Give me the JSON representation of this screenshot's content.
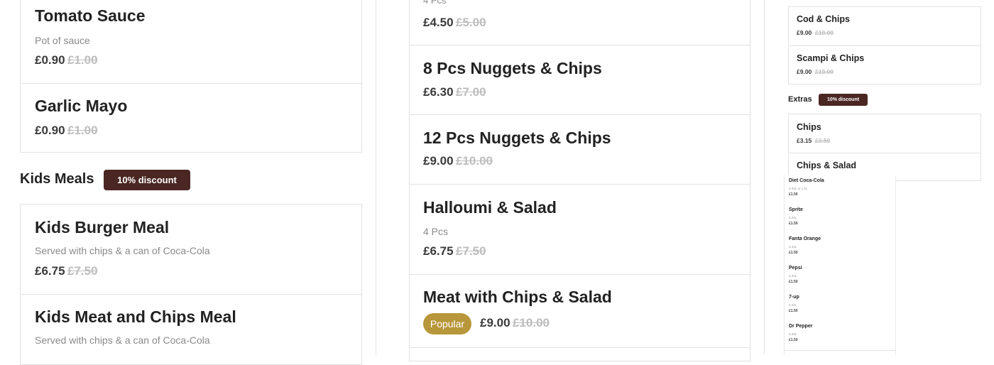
{
  "left": {
    "tomato": {
      "name": "Tomato Sauce",
      "desc": "Pot of sauce",
      "price": "£0.90",
      "old_price": "£1.00"
    },
    "garlic": {
      "name": "Garlic Mayo",
      "price": "£0.90",
      "old_price": "£1.00"
    },
    "kids_section": {
      "title": "Kids Meals",
      "badge": "10% discount"
    },
    "kids_burger": {
      "name": "Kids Burger Meal",
      "desc": "Served with chips & a can of Coca-Cola",
      "price": "£6.75",
      "old_price": "£7.50"
    },
    "kids_meat": {
      "name": "Kids Meat and Chips Meal",
      "desc": "Served with chips & a can of Coca-Cola"
    }
  },
  "middle": {
    "top_partial": {
      "desc": "4 Pcs",
      "price": "£4.50",
      "old_price": "£5.00"
    },
    "nuggets8": {
      "name": "8 Pcs Nuggets & Chips",
      "price": "£6.30",
      "old_price": "£7.00"
    },
    "nuggets12": {
      "name": "12 Pcs Nuggets & Chips",
      "price": "£9.00",
      "old_price": "£10.00"
    },
    "halloumi": {
      "name": "Halloumi & Salad",
      "desc": "4 Pcs",
      "price": "£6.75",
      "old_price": "£7.50"
    },
    "meat": {
      "name": "Meat with Chips & Salad",
      "badge": "Popular",
      "price": "£9.00",
      "old_price": "£10.00"
    }
  },
  "right": {
    "cod": {
      "name": "Cod & Chips",
      "price": "£9.00",
      "old_price": "£10.00"
    },
    "scampi": {
      "name": "Scampi & Chips",
      "price": "£9.00",
      "old_price": "£10.00"
    },
    "extras": {
      "title": "Extras",
      "badge": "10% discount"
    },
    "chips": {
      "name": "Chips",
      "price": "£3.15",
      "old_price": "£3.50"
    },
    "chips_salad": {
      "name": "Chips & Salad"
    },
    "drinks": [
      {
        "name": "Diet Coca-Cola",
        "size": "0.33L or 1.5L",
        "price": "£1.50"
      },
      {
        "name": "Sprite",
        "size": "0.33L",
        "price": "£1.50"
      },
      {
        "name": "Fanta Orange",
        "size": "0.33L",
        "price": "£1.50"
      },
      {
        "name": "Pepsi",
        "size": "0.33L",
        "price": "£1.50"
      },
      {
        "name": "7-up",
        "size": "0.33L",
        "price": "£1.50"
      },
      {
        "name": "Dr Pepper",
        "size": "0.33L",
        "price": "£1.50"
      }
    ]
  },
  "colors": {
    "badge": "#4a2723",
    "popular": "#b8963a",
    "strike": "#bdbdbd",
    "border": "#e2e2e2"
  }
}
